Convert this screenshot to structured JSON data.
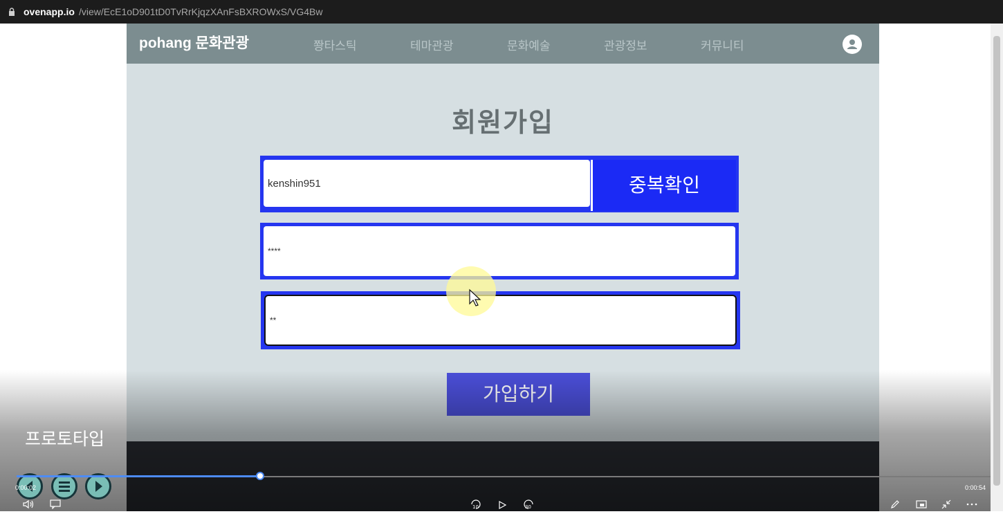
{
  "browser": {
    "url_host": "ovenapp.io",
    "url_path": "/view/EcE1oD901tD0TvRrKjqzXAnFsBXROWxS/VG4Bw"
  },
  "app": {
    "logo": "pohang 문화관광",
    "nav_items": [
      "쫭타스틱",
      "테마관광",
      "문화예술",
      "관광정보",
      "커뮤니티"
    ],
    "title": "회원가입",
    "id_value": "kenshin951",
    "dup_check_label": "중복확인",
    "password_value": "****",
    "password_confirm_value": "**",
    "signup_label": "가입하기"
  },
  "video": {
    "caption": "프로토타입",
    "time_current": "0:00:02",
    "time_total": "0:00:54",
    "progress": 0.25,
    "skip_back": "10",
    "skip_forward": "30"
  },
  "colors": {
    "nav_bg": "#7c8d90",
    "page_bg": "#d6dfe2",
    "accent_blue": "#1b2af5",
    "signup_btn": "#4b4fd9",
    "progress": "#4d8cf5"
  },
  "icons": [
    "lock-icon",
    "user-icon",
    "volume-icon",
    "subtitles-icon",
    "rewind-10-icon",
    "play-icon",
    "forward-30-icon",
    "pen-icon",
    "miniplayer-icon",
    "exit-fullscreen-icon",
    "more-icon"
  ]
}
